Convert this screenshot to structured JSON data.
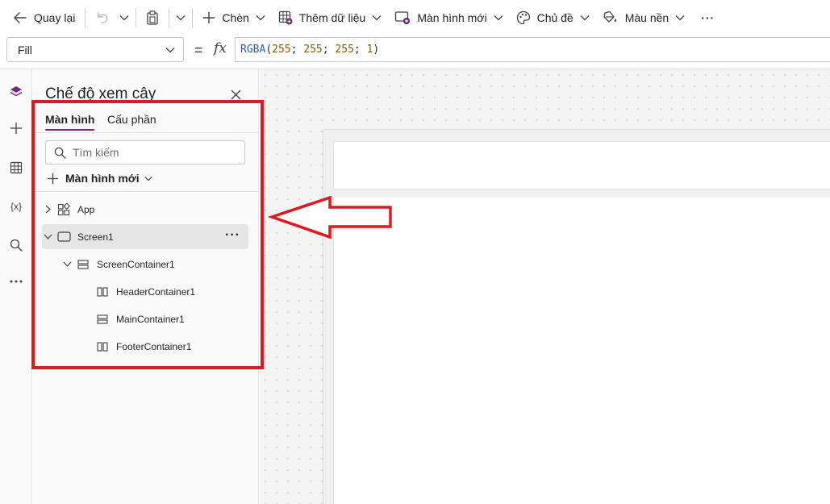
{
  "toolbar": {
    "back_label": "Quay lại",
    "insert_label": "Chèn",
    "add_data_label": "Thêm dữ liệu",
    "new_screen_label": "Màn hình mới",
    "theme_label": "Chủ đề",
    "background_label": "Màu nền",
    "more_label": "···"
  },
  "formula_bar": {
    "property": "Fill",
    "equals": "=",
    "fx": "fx",
    "formula": {
      "fn": "RGBA",
      "open": "(",
      "args": [
        "255",
        "255",
        "255",
        "1"
      ],
      "sep": "; ",
      "close": ")"
    }
  },
  "tree_panel": {
    "title": "Chế độ xem cây",
    "tabs": [
      {
        "label": "Màn hình",
        "active": true
      },
      {
        "label": "Cấu phần",
        "active": false
      }
    ],
    "search_placeholder": "Tìm kiếm",
    "new_screen_label": "Màn hình mới",
    "items": [
      {
        "label": "App",
        "icon": "app-icon",
        "expanded": false,
        "selected": false,
        "depth": 0
      },
      {
        "label": "Screen1",
        "icon": "screen-icon",
        "expanded": true,
        "selected": true,
        "depth": 0,
        "more": "···"
      },
      {
        "label": "ScreenContainer1",
        "icon": "vertical-container-icon",
        "expanded": true,
        "selected": false,
        "depth": 1
      },
      {
        "label": "HeaderContainer1",
        "icon": "horizontal-container-icon",
        "selected": false,
        "depth": 2
      },
      {
        "label": "MainContainer1",
        "icon": "vertical-container-icon",
        "selected": false,
        "depth": 2
      },
      {
        "label": "FooterContainer1",
        "icon": "horizontal-container-icon",
        "selected": false,
        "depth": 2
      }
    ]
  },
  "rail": {
    "items": [
      "layers-icon",
      "plus-icon",
      "table-icon",
      "variables-icon",
      "search-icon",
      "more-icon"
    ],
    "variables_glyph": "{x}"
  },
  "colors": {
    "accent": "#742774",
    "highlight": "#e0181f"
  }
}
